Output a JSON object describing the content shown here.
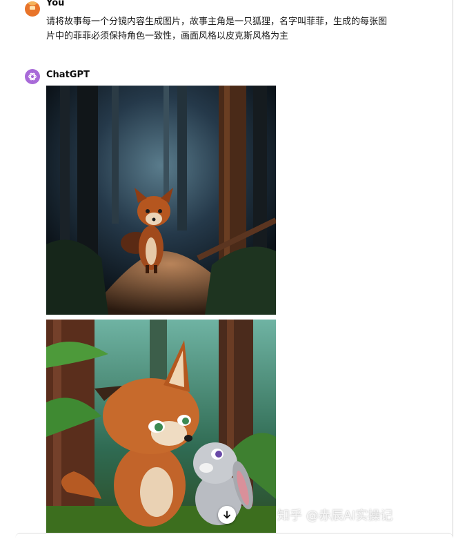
{
  "user": {
    "name": "You",
    "message_line1": "请将故事每一个分镜内容生成图片，故事主角是一只狐狸，名字叫菲菲，生成的每张图",
    "message_line2": "片中的菲菲必须保持角色一致性，画面风格以皮克斯风格为主"
  },
  "assistant": {
    "name": "ChatGPT",
    "images": [
      {
        "description_icon": "image-fox-dark-forest"
      },
      {
        "description_icon": "image-fox-and-rabbit"
      }
    ],
    "download_icon": "download-arrow-icon"
  },
  "watermark": "知乎 @赤辰AI实操记",
  "colors": {
    "user_avatar": "#e8742a",
    "gpt_avatar": "#a86ad8"
  }
}
